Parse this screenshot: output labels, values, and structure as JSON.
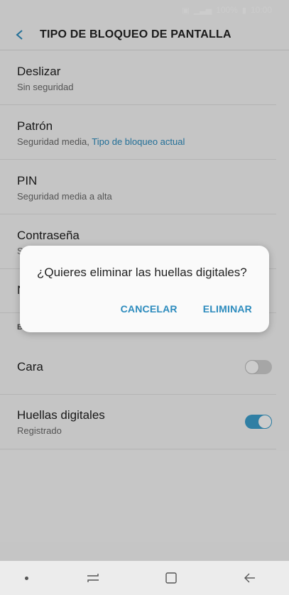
{
  "status_bar": {
    "battery_pct": "100%",
    "time": "10:00"
  },
  "header": {
    "title": "TIPO DE BLOQUEO DE PANTALLA"
  },
  "options": [
    {
      "title": "Deslizar",
      "subtitle": "Sin seguridad"
    },
    {
      "title": "Patrón",
      "subtitle": "Seguridad media,",
      "subtitle_accent": "Tipo de bloqueo actual"
    },
    {
      "title": "PIN",
      "subtitle": "Seguridad media a alta"
    },
    {
      "title": "Contraseña",
      "subtitle": "S"
    }
  ],
  "partial_row": {
    "title": "N"
  },
  "section": {
    "label": "B"
  },
  "biometrics": [
    {
      "title": "Cara",
      "subtitle": "",
      "toggle": "off"
    },
    {
      "title": "Huellas digitales",
      "subtitle": "Registrado",
      "toggle": "on"
    }
  ],
  "dialog": {
    "message": "¿Quieres eliminar las huellas digitales?",
    "cancel_label": "CANCELAR",
    "confirm_label": "ELIMINAR"
  },
  "colors": {
    "accent": "#2c8bbd",
    "toggle_on": "#3c9fcd"
  }
}
